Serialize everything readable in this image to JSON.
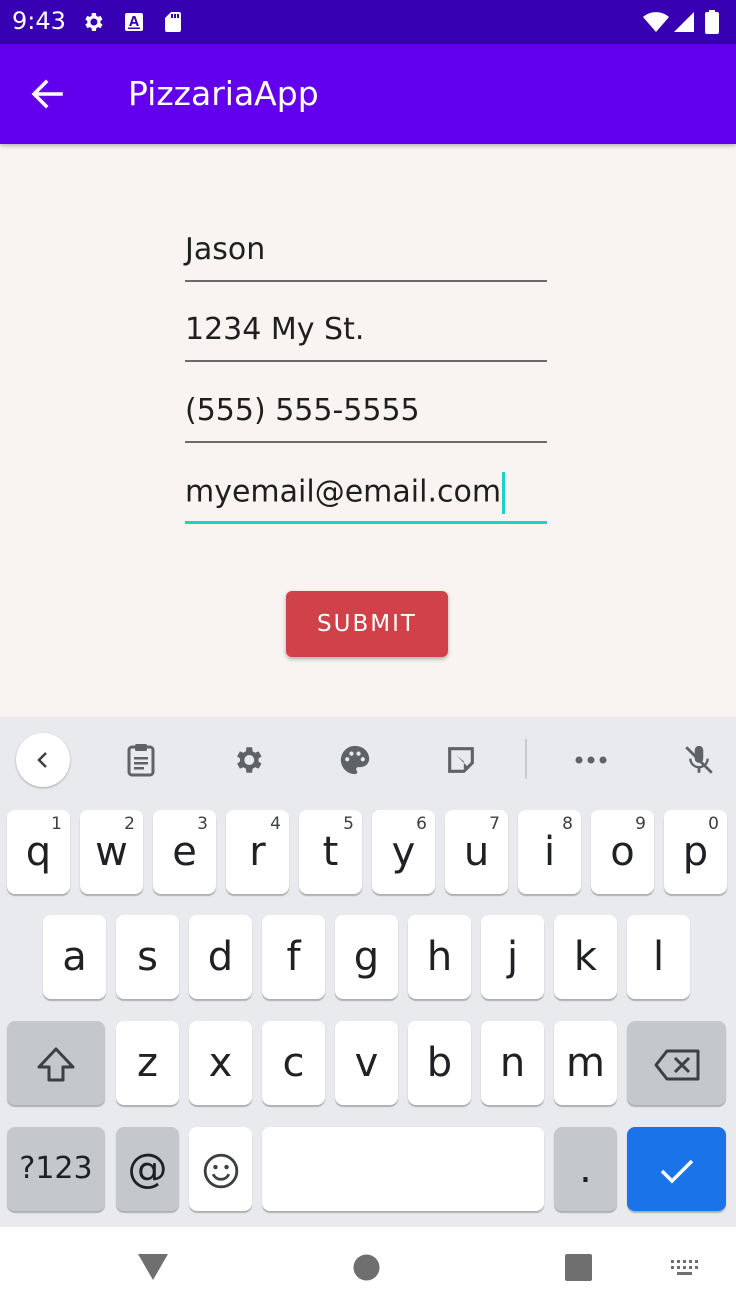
{
  "status_bar": {
    "time": "9:43",
    "icons": [
      "settings-icon",
      "font-a-icon",
      "sd-card-icon",
      "wifi-icon",
      "signal-icon",
      "battery-icon"
    ]
  },
  "app_bar": {
    "title": "PizzariaApp",
    "back_icon": "arrow-back-icon"
  },
  "form": {
    "name": "Jason",
    "address": "1234 My St.",
    "phone": "(555) 555-5555",
    "email": "myemail@email.com",
    "submit_label": "SUBMIT"
  },
  "keyboard": {
    "toolbar_icons": [
      "chevron-left-icon",
      "clipboard-icon",
      "gear-icon",
      "palette-icon",
      "sticker-icon",
      "more-icon",
      "mic-off-icon"
    ],
    "row1": [
      {
        "label": "q",
        "hint": "1"
      },
      {
        "label": "w",
        "hint": "2"
      },
      {
        "label": "e",
        "hint": "3"
      },
      {
        "label": "r",
        "hint": "4"
      },
      {
        "label": "t",
        "hint": "5"
      },
      {
        "label": "y",
        "hint": "6"
      },
      {
        "label": "u",
        "hint": "7"
      },
      {
        "label": "i",
        "hint": "8"
      },
      {
        "label": "o",
        "hint": "9"
      },
      {
        "label": "p",
        "hint": "0"
      }
    ],
    "row2": [
      "a",
      "s",
      "d",
      "f",
      "g",
      "h",
      "j",
      "k",
      "l"
    ],
    "row3": [
      "z",
      "x",
      "c",
      "v",
      "b",
      "n",
      "m"
    ],
    "symbols_label": "?123",
    "at_label": "@",
    "period_label": "."
  },
  "colors": {
    "status_bar": "#3700b3",
    "app_bar": "#6200ee",
    "accent": "#1fd0c6",
    "submit": "#d0414a",
    "enter_key": "#1a73e8"
  },
  "nav_bar": {
    "icons": [
      "back-triangle-icon",
      "home-circle-icon",
      "recents-square-icon",
      "keyboard-switch-icon"
    ]
  }
}
